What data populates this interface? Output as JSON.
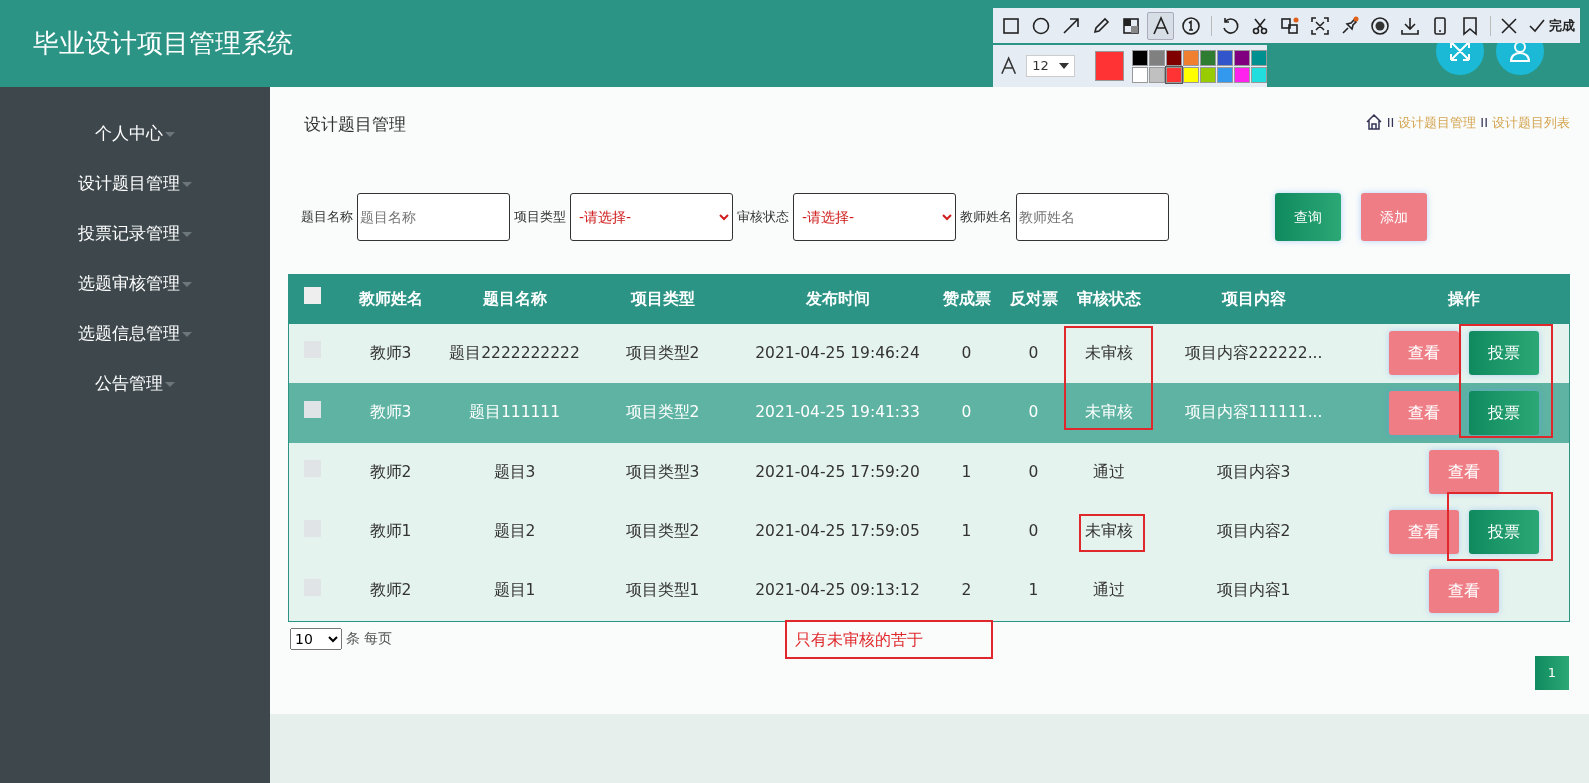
{
  "header": {
    "title": "毕业设计项目管理系统"
  },
  "capture_toolbar": {
    "tools": [
      {
        "kind": "rectangle",
        "selected": false
      },
      {
        "kind": "ellipse",
        "selected": false
      },
      {
        "kind": "arrow",
        "selected": false
      },
      {
        "kind": "pencil",
        "selected": false
      },
      {
        "kind": "mosaic",
        "selected": false
      },
      {
        "kind": "text",
        "selected": true
      },
      {
        "kind": "number",
        "selected": false
      },
      {
        "kind": "undo",
        "selected": false
      },
      {
        "kind": "scissors",
        "selected": false
      },
      {
        "kind": "translate",
        "selected": false
      },
      {
        "kind": "ocr",
        "selected": false
      },
      {
        "kind": "pin",
        "selected": false
      },
      {
        "kind": "record",
        "selected": false
      },
      {
        "kind": "download",
        "selected": false
      },
      {
        "kind": "phone",
        "selected": false
      },
      {
        "kind": "bookmark",
        "selected": false
      },
      {
        "kind": "close",
        "selected": false
      }
    ],
    "done_label": "完成",
    "font_size": "12",
    "palette": [
      {
        "color": "#000000",
        "selected": false
      },
      {
        "color": "#808080",
        "selected": false
      },
      {
        "color": "#800000",
        "selected": false
      },
      {
        "color": "#f08030",
        "selected": false
      },
      {
        "color": "#2e7d32",
        "selected": false
      },
      {
        "color": "#3355cc",
        "selected": false
      },
      {
        "color": "#800080",
        "selected": false
      },
      {
        "color": "#009090",
        "selected": false
      },
      {
        "color": "#ffffff",
        "selected": false
      },
      {
        "color": "#c0c0c0",
        "selected": false
      },
      {
        "color": "#ff3333",
        "selected": true
      },
      {
        "color": "#ffff00",
        "selected": false
      },
      {
        "color": "#99cc00",
        "selected": false
      },
      {
        "color": "#3399ee",
        "selected": false
      },
      {
        "color": "#ff22ee",
        "selected": false
      },
      {
        "color": "#22dddd",
        "selected": false
      }
    ]
  },
  "sidebar": {
    "items": [
      "个人中心",
      "设计题目管理",
      "投票记录管理",
      "选题审核管理",
      "选题信息管理",
      "公告管理"
    ]
  },
  "page_title": "设计题目管理",
  "breadcrumb": {
    "items": [
      {
        "separator": "II",
        "label": "设计题目管理"
      },
      {
        "separator": "II",
        "label": "设计题目列表"
      }
    ]
  },
  "filters": [
    {
      "kind": "input",
      "label": "题目名称",
      "placeholder": "题目名称"
    },
    {
      "kind": "select",
      "label": "项目类型",
      "value": "-请选择-"
    },
    {
      "kind": "select",
      "label": "审核状态",
      "value": "-请选择-"
    },
    {
      "kind": "input",
      "label": "教师姓名",
      "placeholder": "教师姓名"
    }
  ],
  "filter_buttons": [
    {
      "kind": "search",
      "label": "查询"
    },
    {
      "kind": "add",
      "label": "添加"
    }
  ],
  "table": {
    "header_checked": false,
    "columns": [
      "教师姓名",
      "题目名称",
      "项目类型",
      "发布时间",
      "赞成票",
      "反对票",
      "审核状态",
      "项目内容",
      "操作"
    ],
    "rows": [
      {
        "selected": false,
        "checked": false,
        "cells": [
          "教师3",
          "题目2222222222",
          "项目类型2",
          "2021-04-25 19:46:24",
          "0",
          "0",
          "未审核",
          "项目内容222222..."
        ],
        "actions": [
          {
            "kind": "view",
            "label": "查看"
          },
          {
            "kind": "vote",
            "label": "投票"
          }
        ]
      },
      {
        "selected": true,
        "checked": false,
        "cells": [
          "教师3",
          "题目111111",
          "项目类型2",
          "2021-04-25 19:41:33",
          "0",
          "0",
          "未审核",
          "项目内容111111..."
        ],
        "actions": [
          {
            "kind": "view",
            "label": "查看"
          },
          {
            "kind": "vote",
            "label": "投票"
          }
        ]
      },
      {
        "selected": false,
        "checked": false,
        "cells": [
          "教师2",
          "题目3",
          "项目类型3",
          "2021-04-25 17:59:20",
          "1",
          "0",
          "通过",
          "项目内容3"
        ],
        "actions": [
          {
            "kind": "view",
            "label": "查看"
          }
        ]
      },
      {
        "selected": false,
        "checked": false,
        "cells": [
          "教师1",
          "题目2",
          "项目类型2",
          "2021-04-25 17:59:05",
          "1",
          "0",
          "未审核",
          "项目内容2"
        ],
        "actions": [
          {
            "kind": "view",
            "label": "查看"
          },
          {
            "kind": "vote",
            "label": "投票"
          }
        ]
      },
      {
        "selected": false,
        "checked": false,
        "cells": [
          "教师2",
          "题目1",
          "项目类型1",
          "2021-04-25 09:13:12",
          "2",
          "1",
          "通过",
          "项目内容1"
        ],
        "actions": [
          {
            "kind": "view",
            "label": "查看"
          }
        ]
      }
    ]
  },
  "pagination": {
    "page_size": "10",
    "page_size_label": "条 每页",
    "pages": [
      {
        "label": "1",
        "selected": true
      }
    ]
  },
  "annotation": {
    "text": "只有未审核的苦于"
  }
}
